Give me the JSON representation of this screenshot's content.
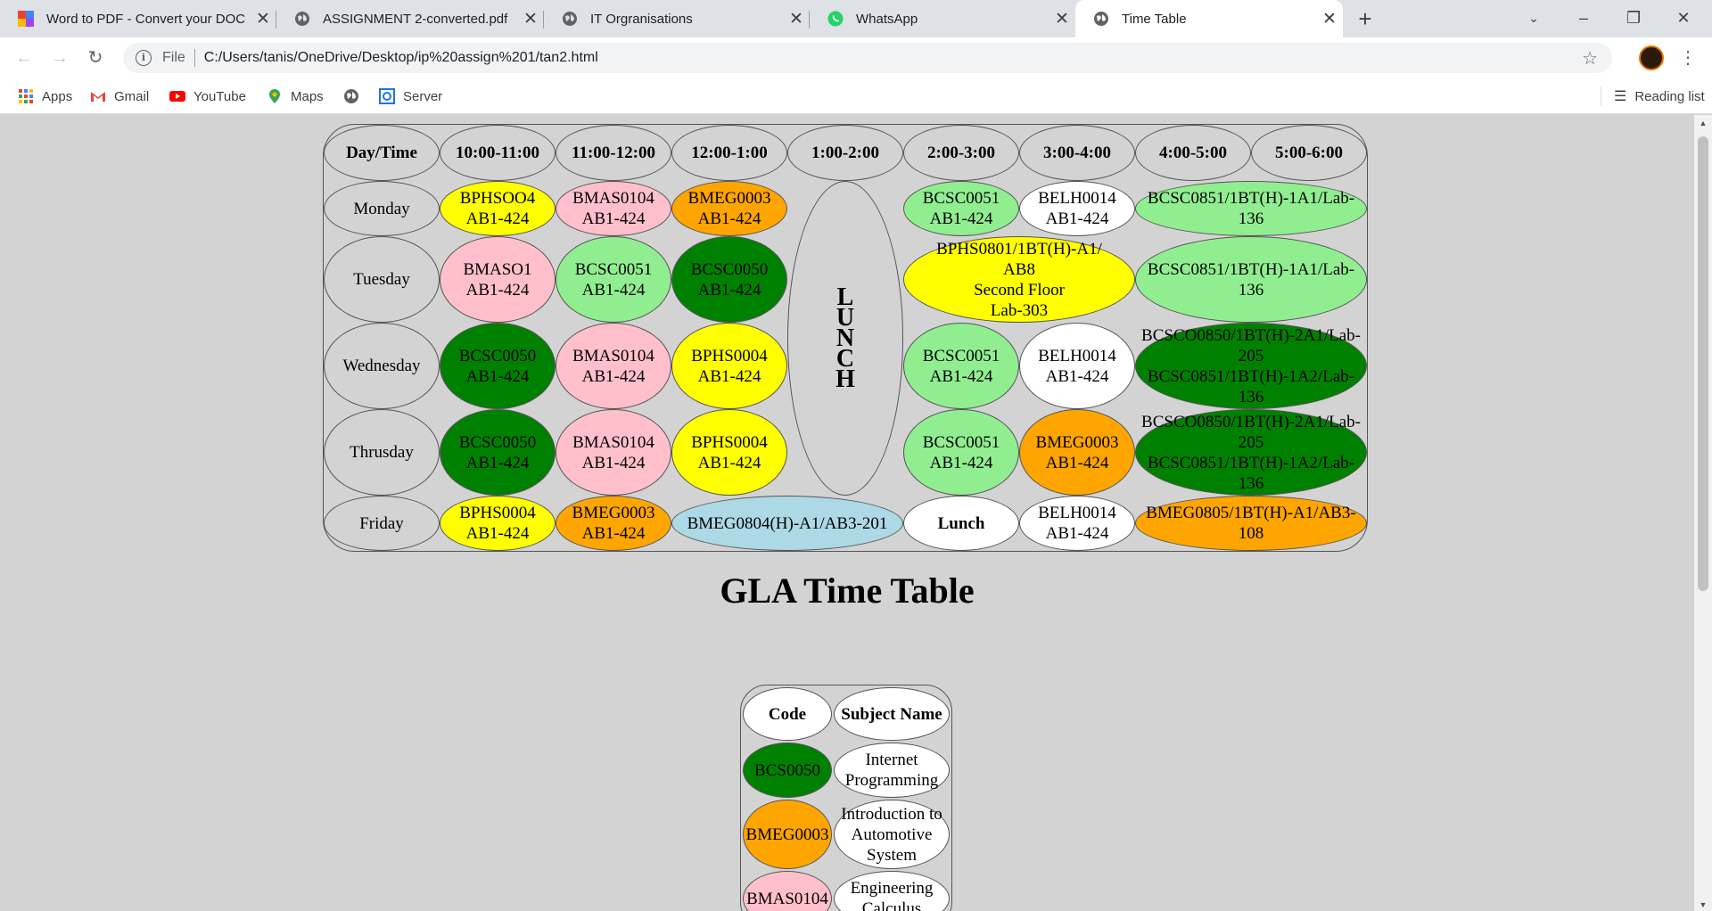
{
  "browser": {
    "tabs": [
      {
        "title": "Word to PDF - Convert your DOC",
        "icon": "word-pdf-icon"
      },
      {
        "title": "ASSIGNMENT 2-converted.pdf",
        "icon": "globe-icon"
      },
      {
        "title": "IT Orgranisations",
        "icon": "globe-icon"
      },
      {
        "title": "WhatsApp",
        "icon": "whatsapp-icon"
      },
      {
        "title": "Time Table",
        "icon": "globe-icon"
      }
    ],
    "address": {
      "scheme": "File",
      "url": "C:/Users/tanis/OneDrive/Desktop/ip%20assign%201/tan2.html"
    },
    "bookmarks": [
      "Apps",
      "Gmail",
      "YouTube",
      "Maps",
      "Server"
    ],
    "reading_list": "Reading list"
  },
  "colors": {
    "yellow": "#ffff00",
    "pink": "#ffc0cb",
    "orange": "#ffa500",
    "light_green": "#90ee90",
    "dark_green": "#008000",
    "white": "#ffffff",
    "light_blue": "#add8e6",
    "gray": "#d3d3d3"
  },
  "timetable": {
    "headers": [
      "Day/Time",
      "10:00-11:00",
      "11:00-12:00",
      "12:00-1:00",
      "1:00-2:00",
      "2:00-3:00",
      "3:00-4:00",
      "4:00-5:00",
      "5:00-6:00"
    ],
    "lunch_letters": [
      "L",
      "U",
      "N",
      "C",
      "H"
    ],
    "days": {
      "monday": "Monday",
      "tuesday": "Tuesday",
      "wednesday": "Wednesday",
      "thursday": "Thrusday",
      "friday": "Friday"
    },
    "mon": {
      "s1": {
        "l1": "BPHSOO4",
        "l2": "AB1-424"
      },
      "s2": {
        "l1": "BMAS0104",
        "l2": "AB1-424"
      },
      "s3": {
        "l1": "BMEG0003",
        "l2": "AB1-424"
      },
      "s5": {
        "l1": "BCSC0051",
        "l2": "AB1-424"
      },
      "s6": {
        "l1": "BELH0014",
        "l2": "AB1-424"
      },
      "lab": {
        "l1": "BCSC0851/1BT(H)-1A1/Lab-",
        "l2": "136"
      }
    },
    "tue": {
      "s1": {
        "l1": "BMASO1",
        "l2": "AB1-424"
      },
      "s2": {
        "l1": "BCSC0051",
        "l2": "AB1-424"
      },
      "s3": {
        "l1": "BCSC0050",
        "l2": "AB1-424"
      },
      "lab1": {
        "l1": "BPHS0801/1BT(H)-A1/",
        "l2": "AB8",
        "l3": "Second Floor",
        "l4": "Lab-303"
      },
      "lab2": {
        "l1": "BCSC0851/1BT(H)-1A1/Lab-",
        "l2": "136"
      }
    },
    "wed": {
      "s1": {
        "l1": "BCSC0050",
        "l2": "AB1-424"
      },
      "s2": {
        "l1": "BMAS0104",
        "l2": "AB1-424"
      },
      "s3": {
        "l1": "BPHS0004",
        "l2": "AB1-424"
      },
      "s5": {
        "l1": "BCSC0051",
        "l2": "AB1-424"
      },
      "s6": {
        "l1": "BELH0014",
        "l2": "AB1-424"
      },
      "lab": {
        "l1": "BCSCO0850/1BT(H)-2A1/Lab-",
        "l2": "205",
        "l3": "BCSC0851/1BT(H)-1A2/Lab-",
        "l4": "136"
      }
    },
    "thu": {
      "s1": {
        "l1": "BCSC0050",
        "l2": "AB1-424"
      },
      "s2": {
        "l1": "BMAS0104",
        "l2": "AB1-424"
      },
      "s3": {
        "l1": "BPHS0004",
        "l2": "AB1-424"
      },
      "s5": {
        "l1": "BCSC0051",
        "l2": "AB1-424"
      },
      "s6": {
        "l1": "BMEG0003",
        "l2": "AB1-424"
      },
      "lab": {
        "l1": "BCSCO0850/1BT(H)-2A1/Lab-",
        "l2": "205",
        "l3": "BCSC0851/1BT(H)-1A2/Lab-",
        "l4": "136"
      }
    },
    "fri": {
      "s1": {
        "l1": "BPHS0004",
        "l2": "AB1-424"
      },
      "s2": {
        "l1": "BMEG0003",
        "l2": "AB1-424"
      },
      "lab1": {
        "l1": "BMEG0804(H)-A1/AB3-201"
      },
      "lunch": "Lunch",
      "s6": {
        "l1": "BELH0014",
        "l2": "AB1-424"
      },
      "lab2": {
        "l1": "BMEG0805/1BT(H)-A1/AB3-",
        "l2": "108"
      }
    }
  },
  "page_title": "GLA Time Table",
  "subjects": {
    "headers": [
      "Code",
      "Subject Name"
    ],
    "rows": [
      {
        "code": "BCS0050",
        "name_l1": "Internet",
        "name_l2": "Programming",
        "name_l3": ""
      },
      {
        "code": "BMEG0003",
        "name_l1": "Introduction to",
        "name_l2": "Automotive",
        "name_l3": "System"
      },
      {
        "code": "BMAS0104",
        "name_l1": "Engineering",
        "name_l2": "Calculus",
        "name_l3": ""
      }
    ]
  }
}
